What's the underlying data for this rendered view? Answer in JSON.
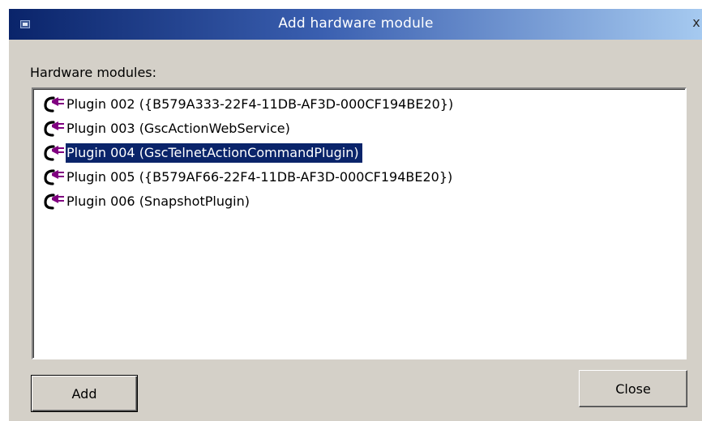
{
  "window": {
    "title": "Add hardware module",
    "close_glyph": "x"
  },
  "list": {
    "label": "Hardware modules:",
    "items": [
      {
        "label": "Plugin 002 ({B579A333-22F4-11DB-AF3D-000CF194BE20})",
        "icon": "plugin-icon",
        "selected": false
      },
      {
        "label": "Plugin 003 (GscActionWebService)",
        "icon": "plugin-icon",
        "selected": false
      },
      {
        "label": "Plugin 004 (GscTelnetActionCommandPlugin)",
        "icon": "plugin-icon",
        "selected": true
      },
      {
        "label": "Plugin 005 ({B579AF66-22F4-11DB-AF3D-000CF194BE20})",
        "icon": "plugin-icon",
        "selected": false
      },
      {
        "label": "Plugin 006 (SnapshotPlugin)",
        "icon": "plugin-icon",
        "selected": false
      }
    ]
  },
  "buttons": {
    "add_label": "Add",
    "close_label": "Close"
  },
  "colors": {
    "selection": "#0a246a",
    "dialog_face": "#d4d0c8",
    "plugin_icon": "#800080"
  }
}
